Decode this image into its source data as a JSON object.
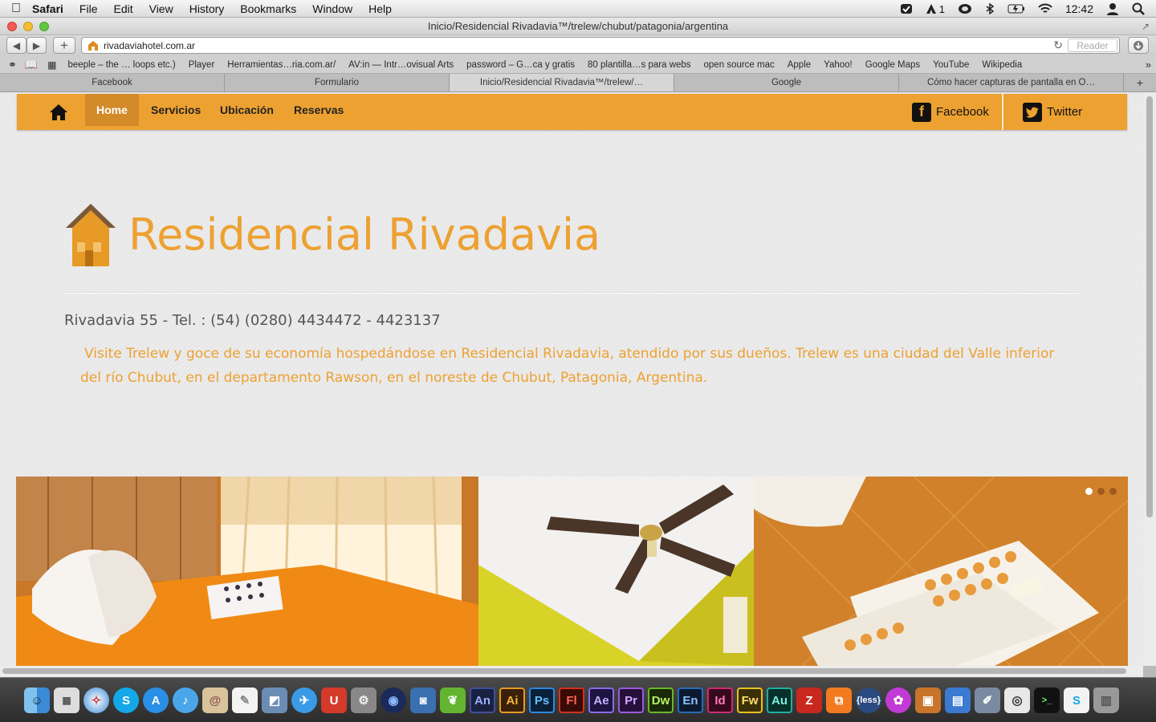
{
  "menubar": {
    "app": "Safari",
    "menus": [
      "File",
      "Edit",
      "View",
      "History",
      "Bookmarks",
      "Window",
      "Help"
    ],
    "status_count": "1",
    "clock": "12:42"
  },
  "window": {
    "title": "Inicio/Residencial Rivadavia™/trelew/chubut/patagonia/argentina",
    "url": "rivadaviahotel.com.ar",
    "reader_label": "Reader",
    "add_label": "+"
  },
  "bookmarks": [
    "beeple – the … loops etc.)",
    "Player",
    "Herramientas…ria.com.ar/",
    "AV:in — Intr…ovisual Arts",
    "password – G…ca y gratis",
    "80 plantilla…s para webs",
    "open source mac",
    "Apple",
    "Yahoo!",
    "Google Maps",
    "YouTube",
    "Wikipedia"
  ],
  "tabs": [
    "Facebook",
    "Formulario",
    "Inicio/Residencial Rivadavia™/trelew/…",
    "Google",
    "Cómo hacer capturas de pantalla en O…"
  ],
  "site": {
    "nav": [
      "Home",
      "Servicios",
      "Ubicación",
      "Reservas"
    ],
    "facebook_label": "Facebook",
    "twitter_label": "Twitter",
    "title": "Residencial Rivadavia",
    "address": "Rivadavia 55 - Tel. : (54) (0280) 4434472 - 4423137",
    "intro": "Visite Trelew y goce de su economía hospedándose en Residencial Rivadavia, atendido por sus dueños. Trelew es una ciudad del Valle inferior del río Chubut, en el departamento Rawson, en el noreste de Chubut, Patagonia, Argentina.",
    "slider_dots": 3
  },
  "dock": {
    "apps": [
      "An",
      "Ai",
      "Ps",
      "Fl",
      "Ae",
      "Pr",
      "Dw",
      "En",
      "Id",
      "Fw",
      "Au"
    ],
    "less_label": "{less}"
  },
  "colors": {
    "accent": "#eda131",
    "accent_dark": "#d38a29",
    "text_gray": "#555555"
  }
}
